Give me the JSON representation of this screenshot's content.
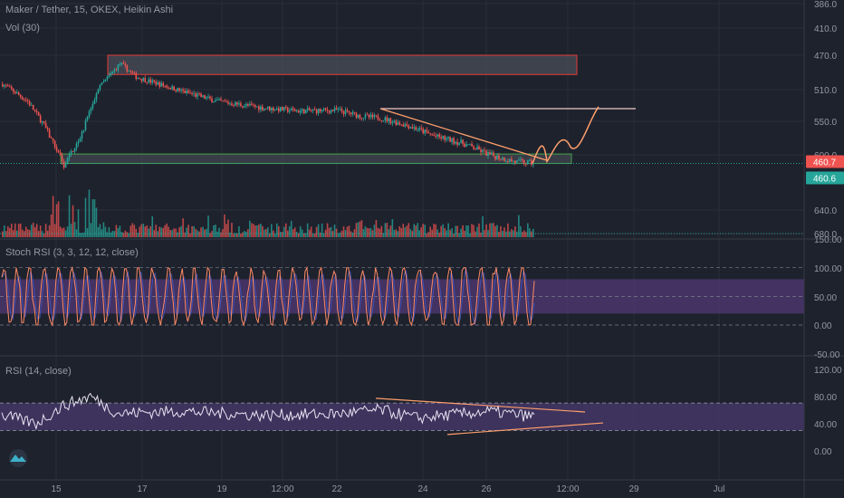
{
  "header": {
    "symbol_line": "Maker / Tether, 15, OKEX, Heikin Ashi",
    "volume_label": "Vol (30)"
  },
  "panes": {
    "stoch_label": "Stoch RSI (3, 3, 12, 12, close)",
    "rsi_label": "RSI (14, close)"
  },
  "price_axis": {
    "ticks": [
      "680.0",
      "640.0",
      "600.0",
      "550.0",
      "510.0",
      "470.0",
      "410.0",
      "386.0"
    ],
    "last_price_badge": "460.7",
    "level_badge": "460.6"
  },
  "stoch_axis": {
    "ticks": [
      "150.00",
      "100.00",
      "50.00",
      "0.00",
      "-50.00"
    ]
  },
  "rsi_axis": {
    "ticks": [
      "120.00",
      "80.00",
      "40.00",
      "0.00"
    ]
  },
  "time_axis": {
    "ticks": [
      "15",
      "17",
      "19",
      "12:00",
      "22",
      "24",
      "26",
      "12:00",
      "29",
      "Jul"
    ]
  },
  "colors": {
    "background": "#1e222d",
    "up": "#26a69a",
    "down": "#ef5350",
    "resistance_box": "#e53935",
    "support_box": "#43a047",
    "stoch_k": "#ff8a65",
    "stoch_d": "#3f51b5",
    "stoch_band": "#5b3d86",
    "rsi_line": "#e9e3f2",
    "rsi_band": "#4a3a72",
    "drawing_line": "#ff9e6b",
    "resistance_line": "#f2c9c9",
    "price_badge": "#ef5350",
    "support_badge": "#26a69a"
  },
  "chart_data": [
    {
      "type": "candlestick",
      "title": "Maker / Tether, 15, OKEX, Heikin Ashi",
      "y_ticks": [
        386,
        410,
        470,
        510,
        550,
        600,
        640,
        680
      ],
      "x_ticks": [
        "15",
        "17",
        "19",
        "12:00",
        "22",
        "24",
        "26",
        "12:00",
        "29",
        "Jul"
      ],
      "last_price": 460.7,
      "anchor_prices": [
        [
          "15",
          558
        ],
        [
          "15",
          535
        ],
        [
          "15",
          505
        ],
        [
          "15",
          458
        ],
        [
          "15",
          492
        ],
        [
          "17",
          552
        ],
        [
          "17",
          588
        ],
        [
          "17",
          568
        ],
        [
          "17",
          562
        ],
        [
          "19",
          548
        ],
        [
          "19",
          535
        ],
        [
          "12:00",
          527
        ],
        [
          "12:00",
          523
        ],
        [
          "22",
          524
        ],
        [
          "22",
          516
        ],
        [
          "22",
          514
        ],
        [
          "24",
          505
        ],
        [
          "24",
          492
        ],
        [
          "24",
          484
        ],
        [
          "26",
          470
        ],
        [
          "26",
          462
        ],
        [
          "26",
          460.7
        ]
      ],
      "zones": [
        {
          "name": "resistance zone",
          "from": 572,
          "to": 600
        },
        {
          "name": "support zone",
          "from": 460.6,
          "to": 471
        }
      ],
      "annotations": [
        {
          "type": "horizontal line",
          "price": 526
        },
        {
          "type": "descending trendline",
          "from_price": 526,
          "to_price": 464
        },
        {
          "type": "projected path",
          "from_price": 460.7,
          "to_price": 525
        }
      ]
    },
    {
      "type": "bar",
      "name": "Vol (30)"
    },
    {
      "type": "line",
      "name": "Stoch RSI (3, 3, 12, 12, close)",
      "ylim": [
        -50,
        150
      ],
      "y_ticks": [
        -50,
        0,
        50,
        100,
        150
      ],
      "band": [
        20,
        80
      ]
    },
    {
      "type": "line",
      "name": "RSI (14, close)",
      "ylim": [
        -10,
        120
      ],
      "y_ticks": [
        0,
        40,
        80,
        120
      ],
      "band": [
        30,
        70
      ],
      "anchor_values": [
        [
          "15",
          52
        ],
        [
          "15",
          40
        ],
        [
          "15",
          66
        ],
        [
          "17",
          80
        ],
        [
          "17",
          55
        ],
        [
          "19",
          58
        ],
        [
          "12:00",
          52
        ],
        [
          "22",
          54
        ],
        [
          "24",
          60
        ],
        [
          "24",
          48
        ],
        [
          "26",
          58
        ],
        [
          "26",
          50
        ]
      ]
    }
  ]
}
